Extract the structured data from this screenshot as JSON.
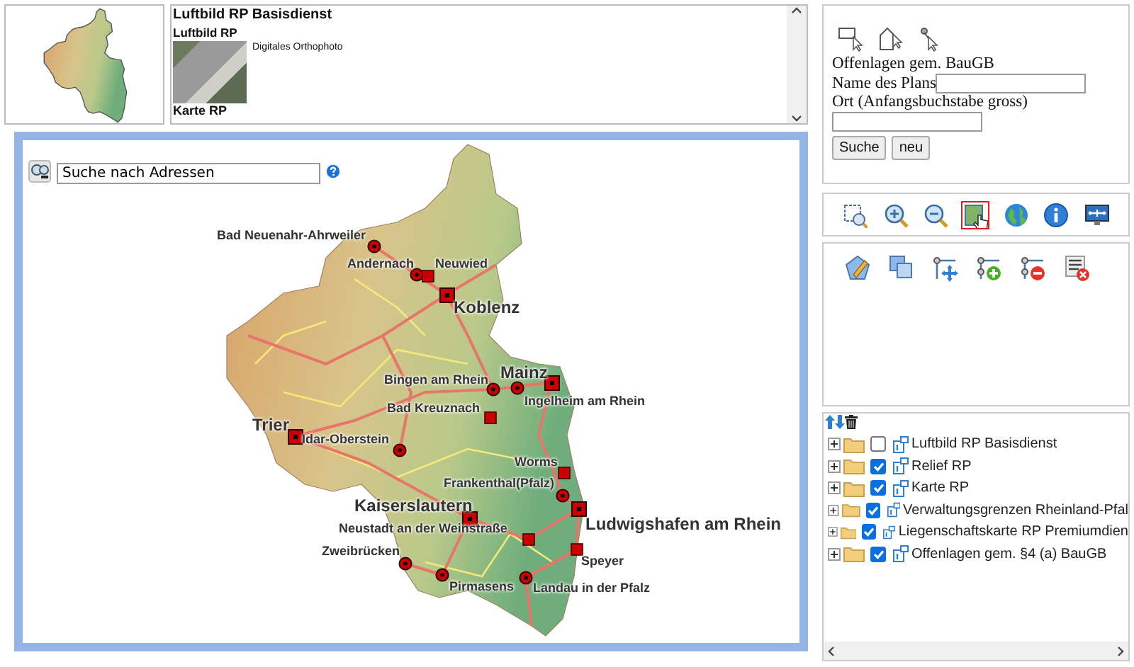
{
  "legend": {
    "title": "Luftbild RP Basisdienst",
    "subtitle": "Luftbild RP",
    "description": "Digitales Orthophoto",
    "next_title": "Karte RP"
  },
  "map": {
    "search": {
      "value": "Suche nach Adressen"
    },
    "cities": [
      {
        "name": "Bad Neuenahr-Ahrweiler",
        "kind": "circle",
        "major": false
      },
      {
        "name": "Andernach",
        "kind": "circle",
        "major": false
      },
      {
        "name": "Neuwied",
        "kind": "square",
        "major": false
      },
      {
        "name": "Koblenz",
        "kind": "bigsquare",
        "major": true
      },
      {
        "name": "Bingen am Rhein",
        "kind": "circle",
        "major": false
      },
      {
        "name": "Mainz",
        "kind": "bigsquare",
        "major": true
      },
      {
        "name": "Ingelheim am Rhein",
        "kind": "circle",
        "major": false
      },
      {
        "name": "Bad Kreuznach",
        "kind": "square",
        "major": false
      },
      {
        "name": "Trier",
        "kind": "bigsquare",
        "major": true
      },
      {
        "name": "Idar-Oberstein",
        "kind": "circle",
        "major": false
      },
      {
        "name": "Worms",
        "kind": "square",
        "major": false
      },
      {
        "name": "Frankenthal(Pfalz)",
        "kind": "circle",
        "major": false
      },
      {
        "name": "Kaiserslautern",
        "kind": "bigsquare",
        "major": true
      },
      {
        "name": "Neustadt an der Weinstraße",
        "kind": "square",
        "major": false
      },
      {
        "name": "Ludwigshafen am Rhein",
        "kind": "bigsquare",
        "major": true
      },
      {
        "name": "Zweibrücken",
        "kind": "circle",
        "major": false
      },
      {
        "name": "Speyer",
        "kind": "square",
        "major": false
      },
      {
        "name": "Pirmasens",
        "kind": "circle",
        "major": false
      },
      {
        "name": "Landau in der Pfalz",
        "kind": "circle",
        "major": false
      }
    ]
  },
  "select_panel": {
    "tools": [
      {
        "kind": "rectangle"
      },
      {
        "kind": "polygon"
      },
      {
        "kind": "point"
      }
    ],
    "title": "Offenlagen gem. BauGB",
    "plan_label": "Name des Plans",
    "place_label": "Ort (Anfangsbuchstabe gross)",
    "buttons": [
      {
        "label": "Suche"
      },
      {
        "label": "neu"
      }
    ]
  },
  "navigation": [
    {
      "kind": "zoom-box",
      "selected": false
    },
    {
      "kind": "zoom-in",
      "selected": false
    },
    {
      "kind": "zoom-out",
      "selected": false
    },
    {
      "kind": "pan",
      "selected": true
    },
    {
      "kind": "globe",
      "selected": false
    },
    {
      "kind": "info",
      "selected": false
    },
    {
      "kind": "network",
      "selected": false
    }
  ],
  "edit_tools": [
    {
      "kind": "draw"
    },
    {
      "kind": "merge"
    },
    {
      "kind": "move-vertex"
    },
    {
      "kind": "add-vertex"
    },
    {
      "kind": "remove-vertex"
    },
    {
      "kind": "delete"
    }
  ],
  "layers": [
    {
      "name": "Luftbild RP Basisdienst",
      "checked": false,
      "expanded": false
    },
    {
      "name": "Relief RP",
      "checked": true,
      "expanded": false
    },
    {
      "name": "Karte RP",
      "checked": true,
      "expanded": false
    },
    {
      "name": "Verwaltungsgrenzen Rheinland-Pfal",
      "checked": true,
      "expanded": false
    },
    {
      "name": "Liegenschaftskarte RP Premiumdien",
      "checked": true,
      "expanded": false
    },
    {
      "name": "Offenlagen gem. §4 (a) BauGB",
      "checked": true,
      "expanded": false
    }
  ]
}
